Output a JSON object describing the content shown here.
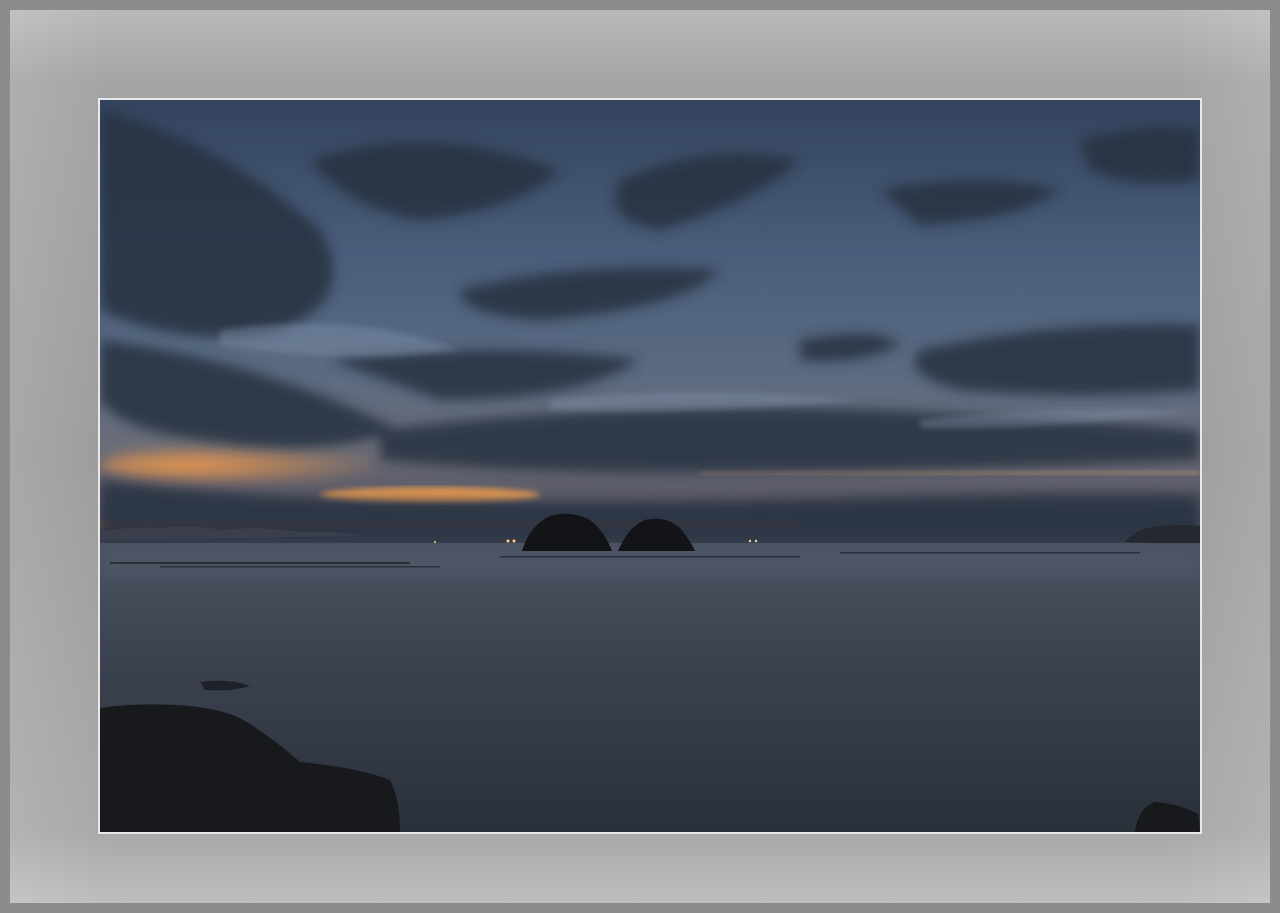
{
  "image": {
    "scene": "seascape-dusk",
    "colors": {
      "sky_top": "#3b4c66",
      "sky_mid": "#50627c",
      "horizon_glow": "#f08a3a",
      "sea": "#3a4250",
      "rock": "#1a1c20",
      "mat": "#a0a0a0",
      "frame_border": "#8c8c8c",
      "photo_border": "#e9e9e9"
    }
  }
}
